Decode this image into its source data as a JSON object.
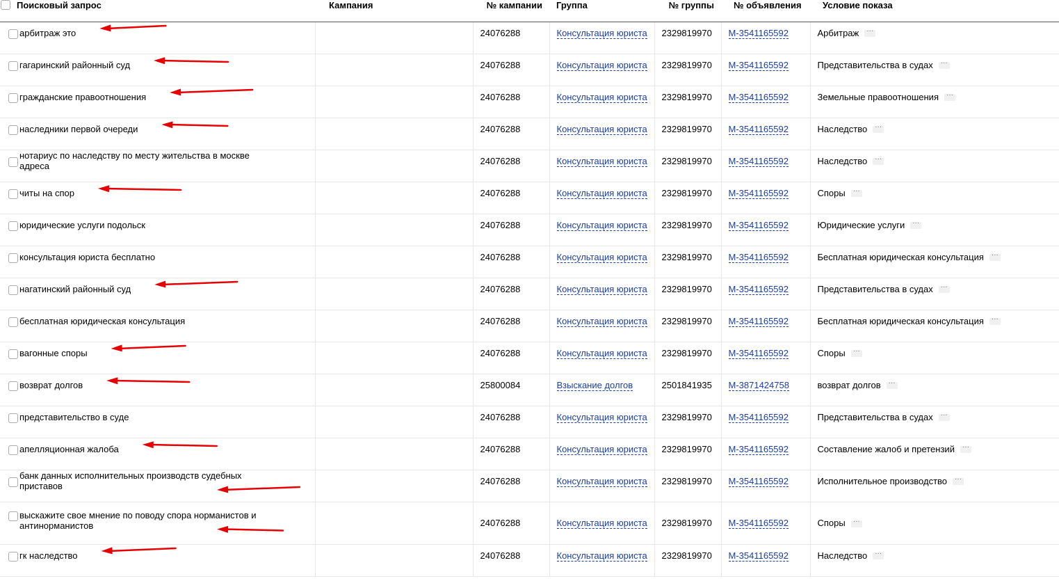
{
  "table": {
    "headers": {
      "query": "Поисковый запрос",
      "campaign": "Кампания",
      "campaign_number": "№ кампании",
      "group": "Группа",
      "group_number": "№ группы",
      "ad_number": "№ объявления",
      "condition": "Условие показа"
    },
    "rows": [
      {
        "query": "арбитраж это",
        "campaign_number": "24076288",
        "group": "Консультация юриста",
        "group_number": "2329819970",
        "ad_number": "M-3541165592",
        "condition": "Арбитраж",
        "marked": true
      },
      {
        "query": "гагаринский районный суд",
        "campaign_number": "24076288",
        "group": "Консультация юриста",
        "group_number": "2329819970",
        "ad_number": "M-3541165592",
        "condition": "Представительства в судах",
        "marked": true
      },
      {
        "query": "гражданские правоотношения",
        "campaign_number": "24076288",
        "group": "Консультация юриста",
        "group_number": "2329819970",
        "ad_number": "M-3541165592",
        "condition": "Земельные правоотношения",
        "marked": true
      },
      {
        "query": "наследники первой очереди",
        "campaign_number": "24076288",
        "group": "Консультация юриста",
        "group_number": "2329819970",
        "ad_number": "M-3541165592",
        "condition": "Наследство",
        "marked": true
      },
      {
        "query": "нотариус по наследству по месту жительства в москве адреса",
        "campaign_number": "24076288",
        "group": "Консультация юриста",
        "group_number": "2329819970",
        "ad_number": "M-3541165592",
        "condition": "Наследство",
        "marked": false
      },
      {
        "query": "читы на спор",
        "campaign_number": "24076288",
        "group": "Консультация юриста",
        "group_number": "2329819970",
        "ad_number": "M-3541165592",
        "condition": "Споры",
        "marked": true
      },
      {
        "query": "юридические услуги подольск",
        "campaign_number": "24076288",
        "group": "Консультация юриста",
        "group_number": "2329819970",
        "ad_number": "M-3541165592",
        "condition": "Юридические услуги",
        "marked": false
      },
      {
        "query": "консультация юриста бесплатно",
        "campaign_number": "24076288",
        "group": "Консультация юриста",
        "group_number": "2329819970",
        "ad_number": "M-3541165592",
        "condition": "Бесплатная юридическая консультация",
        "marked": false
      },
      {
        "query": "нагатинский районный суд",
        "campaign_number": "24076288",
        "group": "Консультация юриста",
        "group_number": "2329819970",
        "ad_number": "M-3541165592",
        "condition": "Представительства в судах",
        "marked": true
      },
      {
        "query": "бесплатная юридическая консультация",
        "campaign_number": "24076288",
        "group": "Консультация юриста",
        "group_number": "2329819970",
        "ad_number": "M-3541165592",
        "condition": "Бесплатная юридическая консультация",
        "marked": false
      },
      {
        "query": "вагонные споры",
        "campaign_number": "24076288",
        "group": "Консультация юриста",
        "group_number": "2329819970",
        "ad_number": "M-3541165592",
        "condition": "Споры",
        "marked": true
      },
      {
        "query": "возврат долгов",
        "campaign_number": "25800084",
        "group": "Взыскание долгов",
        "group_number": "2501841935",
        "ad_number": "M-3871424758",
        "condition": "возврат долгов",
        "marked": true
      },
      {
        "query": "представительство в суде",
        "campaign_number": "24076288",
        "group": "Консультация юриста",
        "group_number": "2329819970",
        "ad_number": "M-3541165592",
        "condition": "Представительства в судах",
        "marked": false
      },
      {
        "query": "апелляционная жалоба",
        "campaign_number": "24076288",
        "group": "Консультация юриста",
        "group_number": "2329819970",
        "ad_number": "M-3541165592",
        "condition": "Составление жалоб и претензий",
        "marked": true
      },
      {
        "query": "банк данных исполнительных производств судебных приставов",
        "campaign_number": "24076288",
        "group": "Консультация юриста",
        "group_number": "2329819970",
        "ad_number": "M-3541165592",
        "condition": "Исполнительное производство",
        "marked": true
      },
      {
        "query": "выскажите свое мнение по поводу спора норманистов и антинорманистов",
        "campaign_number": "24076288",
        "group": "Консультация юриста",
        "group_number": "2329819970",
        "ad_number": "M-3541165592",
        "condition": "Споры",
        "marked": true
      },
      {
        "query": "гк наследство",
        "campaign_number": "24076288",
        "group": "Консультация юриста",
        "group_number": "2329819970",
        "ad_number": "M-3541165592",
        "condition": "Наследство",
        "marked": true
      }
    ]
  },
  "colors": {
    "link": "#1a3ea8",
    "annotation_arrow": "#e60000"
  },
  "icons": {
    "row_menu": "ellipsis-icon",
    "annotation": "red-arrow-icon"
  }
}
